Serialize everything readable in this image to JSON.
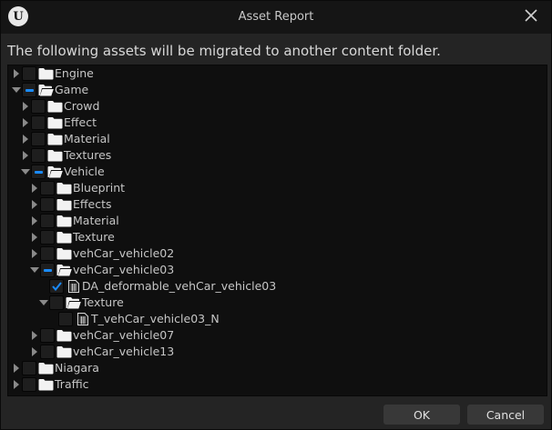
{
  "window": {
    "title": "Asset Report"
  },
  "message": "The following assets will be migrated to another content folder.",
  "tree": [
    {
      "label": "Engine",
      "depth": 0,
      "expand": "collapsed",
      "check": "unchecked",
      "icon": "folder-icon"
    },
    {
      "label": "Game",
      "depth": 0,
      "expand": "expanded",
      "check": "partial",
      "icon": "folder-open-icon"
    },
    {
      "label": "Crowd",
      "depth": 1,
      "expand": "collapsed",
      "check": "unchecked",
      "icon": "folder-icon"
    },
    {
      "label": "Effect",
      "depth": 1,
      "expand": "collapsed",
      "check": "unchecked",
      "icon": "folder-icon"
    },
    {
      "label": "Material",
      "depth": 1,
      "expand": "collapsed",
      "check": "unchecked",
      "icon": "folder-icon"
    },
    {
      "label": "Textures",
      "depth": 1,
      "expand": "collapsed",
      "check": "unchecked",
      "icon": "folder-icon"
    },
    {
      "label": "Vehicle",
      "depth": 1,
      "expand": "expanded",
      "check": "partial",
      "icon": "folder-open-icon"
    },
    {
      "label": "Blueprint",
      "depth": 2,
      "expand": "collapsed",
      "check": "unchecked",
      "icon": "folder-icon"
    },
    {
      "label": "Effects",
      "depth": 2,
      "expand": "collapsed",
      "check": "unchecked",
      "icon": "folder-icon"
    },
    {
      "label": "Material",
      "depth": 2,
      "expand": "collapsed",
      "check": "unchecked",
      "icon": "folder-icon"
    },
    {
      "label": "Texture",
      "depth": 2,
      "expand": "collapsed",
      "check": "unchecked",
      "icon": "folder-icon"
    },
    {
      "label": "vehCar_vehicle02",
      "depth": 2,
      "expand": "collapsed",
      "check": "unchecked",
      "icon": "folder-icon"
    },
    {
      "label": "vehCar_vehicle03",
      "depth": 2,
      "expand": "expanded",
      "check": "partial",
      "icon": "folder-open-icon"
    },
    {
      "label": "DA_deformable_vehCar_vehicle03",
      "depth": 3,
      "expand": "none",
      "check": "checked",
      "icon": "asset-file-icon"
    },
    {
      "label": "Texture",
      "depth": 3,
      "expand": "expanded",
      "check": "unchecked",
      "icon": "folder-open-icon"
    },
    {
      "label": "T_vehCar_vehicle03_N",
      "depth": 4,
      "expand": "none",
      "check": "unchecked",
      "icon": "asset-file-icon"
    },
    {
      "label": "vehCar_vehicle07",
      "depth": 2,
      "expand": "collapsed",
      "check": "unchecked",
      "icon": "folder-icon"
    },
    {
      "label": "vehCar_vehicle13",
      "depth": 2,
      "expand": "collapsed",
      "check": "unchecked",
      "icon": "folder-icon"
    },
    {
      "label": "Niagara",
      "depth": 0,
      "expand": "collapsed",
      "check": "unchecked",
      "icon": "folder-icon"
    },
    {
      "label": "Traffic",
      "depth": 0,
      "expand": "collapsed",
      "check": "unchecked",
      "icon": "folder-icon"
    }
  ],
  "buttons": {
    "ok": "OK",
    "cancel": "Cancel"
  },
  "colors": {
    "accent": "#1a8bff",
    "background": "#242424",
    "tree_background": "#0f0f0f",
    "titlebar": "#151515"
  }
}
